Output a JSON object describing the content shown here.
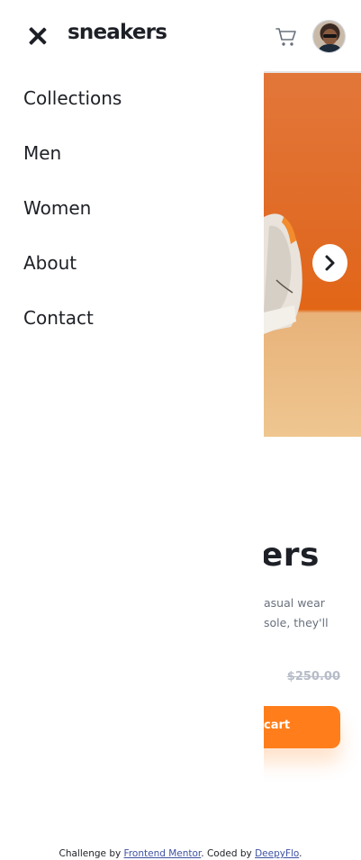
{
  "brand": {
    "logo": "sneakers"
  },
  "header": {
    "close_icon": "close-icon",
    "cart_icon": "cart-icon"
  },
  "nav": {
    "items": [
      {
        "label": "Collections"
      },
      {
        "label": "Men"
      },
      {
        "label": "Women"
      },
      {
        "label": "About"
      },
      {
        "label": "Contact"
      }
    ]
  },
  "product": {
    "title_fragment": "ers",
    "desc_line1": "asual wear",
    "desc_line2": "sole, they'll",
    "old_price": "$250.00",
    "add_button_fragment": "cart",
    "next_icon": "chevron-right-icon"
  },
  "footer": {
    "prefix": "Challenge by ",
    "link1": "Frontend Mentor",
    "middle": ". Coded by ",
    "link2": "DeepyFlo",
    "suffix": "."
  },
  "colors": {
    "accent": "#ff7e1b",
    "text": "#1d2026",
    "muted": "#69707d"
  }
}
